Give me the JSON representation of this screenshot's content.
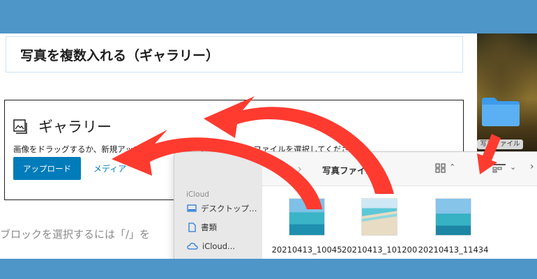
{
  "editor": {
    "heading_text": "写真を複数入れる（ギャラリー）",
    "gallery": {
      "title": "ギャラリー",
      "instructions": "画像をドラッグするか、新規アップロードするか、ライブラリからファイルを選択してください。",
      "upload_label": "アップロード",
      "media_library_label": "メディア"
    },
    "block_hint": "ブロックを選択するには「/」を"
  },
  "desktop": {
    "folder_label": "写真ファイル"
  },
  "finder": {
    "title": "写真ファイル",
    "sidebar_section": "iCloud",
    "sidebar_items": [
      {
        "label": "デスクトップ…",
        "icon": "desktop-icon"
      },
      {
        "label": "書類",
        "icon": "document-icon"
      },
      {
        "label": "iCloud...",
        "icon": "cloud-icon"
      }
    ],
    "files": [
      {
        "name": "20210413_10045",
        "thumb": "sea-photo"
      },
      {
        "name": "20210413_101200",
        "thumb": "beach-photo"
      },
      {
        "name": "20210413_11434",
        "thumb": "sea-photo"
      }
    ]
  },
  "colors": {
    "background": "#4e95c8",
    "accent": "#007cba",
    "arrow": "#ff3b30"
  }
}
